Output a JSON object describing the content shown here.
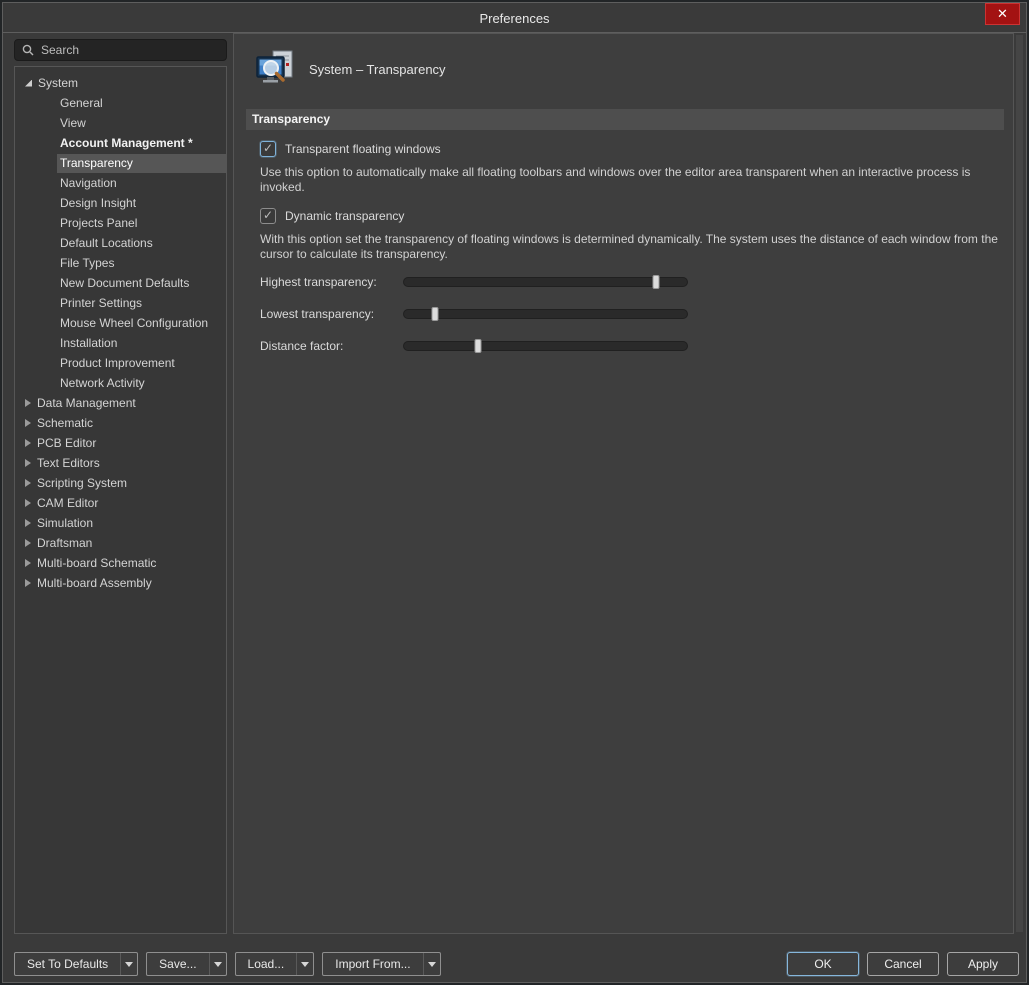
{
  "window": {
    "title": "Preferences",
    "close_glyph": "✕"
  },
  "colors": {
    "accent_blue": "#7fb2d9",
    "close_red": "#a31212",
    "selection_gray": "#565656",
    "panel_bg": "#3e3e3e",
    "window_bg": "#3a3a3a"
  },
  "sidebar": {
    "search_placeholder": "Search",
    "tree": [
      {
        "label": "System",
        "level": 0,
        "state": "expanded"
      },
      {
        "label": "General",
        "level": 1
      },
      {
        "label": "View",
        "level": 1
      },
      {
        "label": "Account Management *",
        "level": 1,
        "bold": true
      },
      {
        "label": "Transparency",
        "level": 1,
        "selected": true
      },
      {
        "label": "Navigation",
        "level": 1
      },
      {
        "label": "Design Insight",
        "level": 1
      },
      {
        "label": "Projects Panel",
        "level": 1
      },
      {
        "label": "Default Locations",
        "level": 1
      },
      {
        "label": "File Types",
        "level": 1
      },
      {
        "label": "New Document Defaults",
        "level": 1
      },
      {
        "label": "Printer Settings",
        "level": 1
      },
      {
        "label": "Mouse Wheel Configuration",
        "level": 1
      },
      {
        "label": "Installation",
        "level": 1
      },
      {
        "label": "Product Improvement",
        "level": 1
      },
      {
        "label": "Network Activity",
        "level": 1
      },
      {
        "label": "Data Management",
        "level": 0,
        "state": "collapsed"
      },
      {
        "label": "Schematic",
        "level": 0,
        "state": "collapsed"
      },
      {
        "label": "PCB Editor",
        "level": 0,
        "state": "collapsed"
      },
      {
        "label": "Text Editors",
        "level": 0,
        "state": "collapsed"
      },
      {
        "label": "Scripting System",
        "level": 0,
        "state": "collapsed"
      },
      {
        "label": "CAM Editor",
        "level": 0,
        "state": "collapsed"
      },
      {
        "label": "Simulation",
        "level": 0,
        "state": "collapsed"
      },
      {
        "label": "Draftsman",
        "level": 0,
        "state": "collapsed"
      },
      {
        "label": "Multi-board Schematic",
        "level": 0,
        "state": "collapsed"
      },
      {
        "label": "Multi-board Assembly",
        "level": 0,
        "state": "collapsed"
      }
    ]
  },
  "main": {
    "page_title": "System – Transparency",
    "section_title": "Transparency",
    "options": [
      {
        "label": "Transparent floating windows",
        "checked": true,
        "focused": true,
        "description": "Use this option to automatically make all floating toolbars and windows over the editor area transparent when an interactive process is invoked."
      },
      {
        "label": "Dynamic transparency",
        "checked": true,
        "focused": false,
        "description": "With this option set the transparency of floating windows is determined dynamically. The system uses the distance of each window from the cursor to calculate its transparency."
      }
    ],
    "sliders": [
      {
        "label": "Highest transparency:",
        "value_pct": 89
      },
      {
        "label": "Lowest transparency:",
        "value_pct": 11
      },
      {
        "label": "Distance factor:",
        "value_pct": 26
      }
    ]
  },
  "footer": {
    "split_buttons": [
      {
        "label": "Set To Defaults"
      },
      {
        "label": "Save..."
      },
      {
        "label": "Load..."
      },
      {
        "label": "Import From..."
      }
    ],
    "buttons": [
      {
        "label": "OK",
        "primary": true
      },
      {
        "label": "Cancel",
        "primary": false
      },
      {
        "label": "Apply",
        "primary": false
      }
    ]
  }
}
